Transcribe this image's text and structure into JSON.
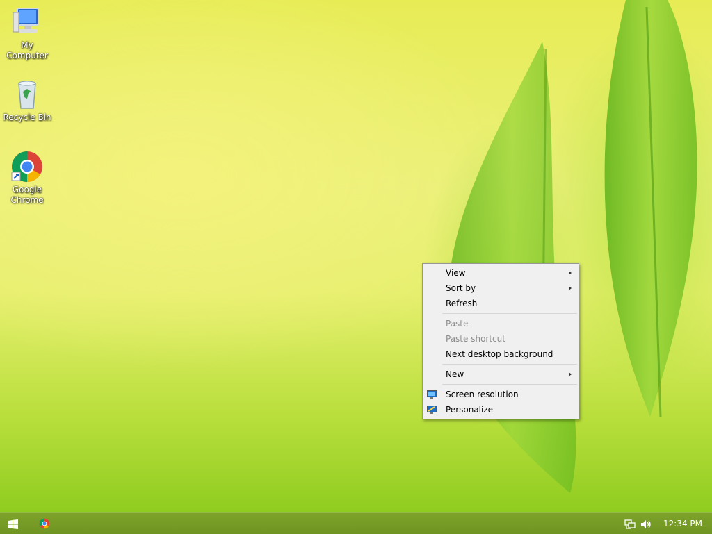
{
  "desktop": {
    "icons": [
      {
        "label": "My Computer"
      },
      {
        "label": "Recycle Bin"
      },
      {
        "label": "Google Chrome"
      }
    ]
  },
  "context_menu": {
    "items": [
      {
        "label": "View",
        "submenu": true,
        "enabled": true
      },
      {
        "label": "Sort by",
        "submenu": true,
        "enabled": true
      },
      {
        "label": "Refresh",
        "submenu": false,
        "enabled": true
      },
      {
        "label": "Paste",
        "submenu": false,
        "enabled": false
      },
      {
        "label": "Paste shortcut",
        "submenu": false,
        "enabled": false
      },
      {
        "label": "Next desktop background",
        "submenu": false,
        "enabled": true
      },
      {
        "label": "New",
        "submenu": true,
        "enabled": true
      },
      {
        "label": "Screen resolution",
        "submenu": false,
        "enabled": true,
        "icon": "display-icon"
      },
      {
        "label": "Personalize",
        "submenu": false,
        "enabled": true,
        "icon": "personalize-icon"
      }
    ]
  },
  "taskbar": {
    "clock": "12:34 PM",
    "accent": "#7ea32a"
  }
}
